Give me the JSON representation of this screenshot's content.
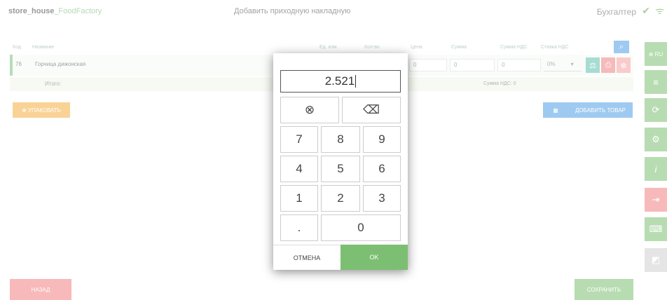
{
  "header": {
    "app_prefix": "store_house_",
    "app_suffix": "FoodFactory",
    "doc_title": "Добавить приходную накладную",
    "user": "Бухгалтер",
    "check_icon": "✔",
    "wifi_icon": "ᯤ"
  },
  "table": {
    "headers": [
      "Код",
      "Название",
      "Ед. изм.",
      "Кол-во",
      "Цена",
      "Сумма",
      "Сумма НДС",
      "Ставка НДС"
    ],
    "row": {
      "code": "76",
      "name": "Горчица дижонская",
      "price": "0",
      "sum": "0",
      "vat_sum": "0",
      "vat_rate": "0%"
    },
    "total_label": "Итого:",
    "vat_total": "Сумма НДС: 0"
  },
  "buttons": {
    "pack": "⊕ упаковать",
    "add_item": "добавить товар",
    "back": "назад",
    "save": "сохранить"
  },
  "sidebar": {
    "lang": "⊕ RU"
  },
  "numpad": {
    "value": "2.521",
    "clear_icon": "⊗",
    "backspace_icon": "⌫",
    "keys": [
      "7",
      "8",
      "9",
      "4",
      "5",
      "6",
      "1",
      "2",
      "3",
      ".",
      "0"
    ],
    "cancel": "ОТМЕНА",
    "ok": "OK"
  },
  "colors": {
    "accent": "#7cbf72",
    "danger": "#f08080",
    "blue": "#4f9fe6",
    "orange": "#f5b041"
  }
}
